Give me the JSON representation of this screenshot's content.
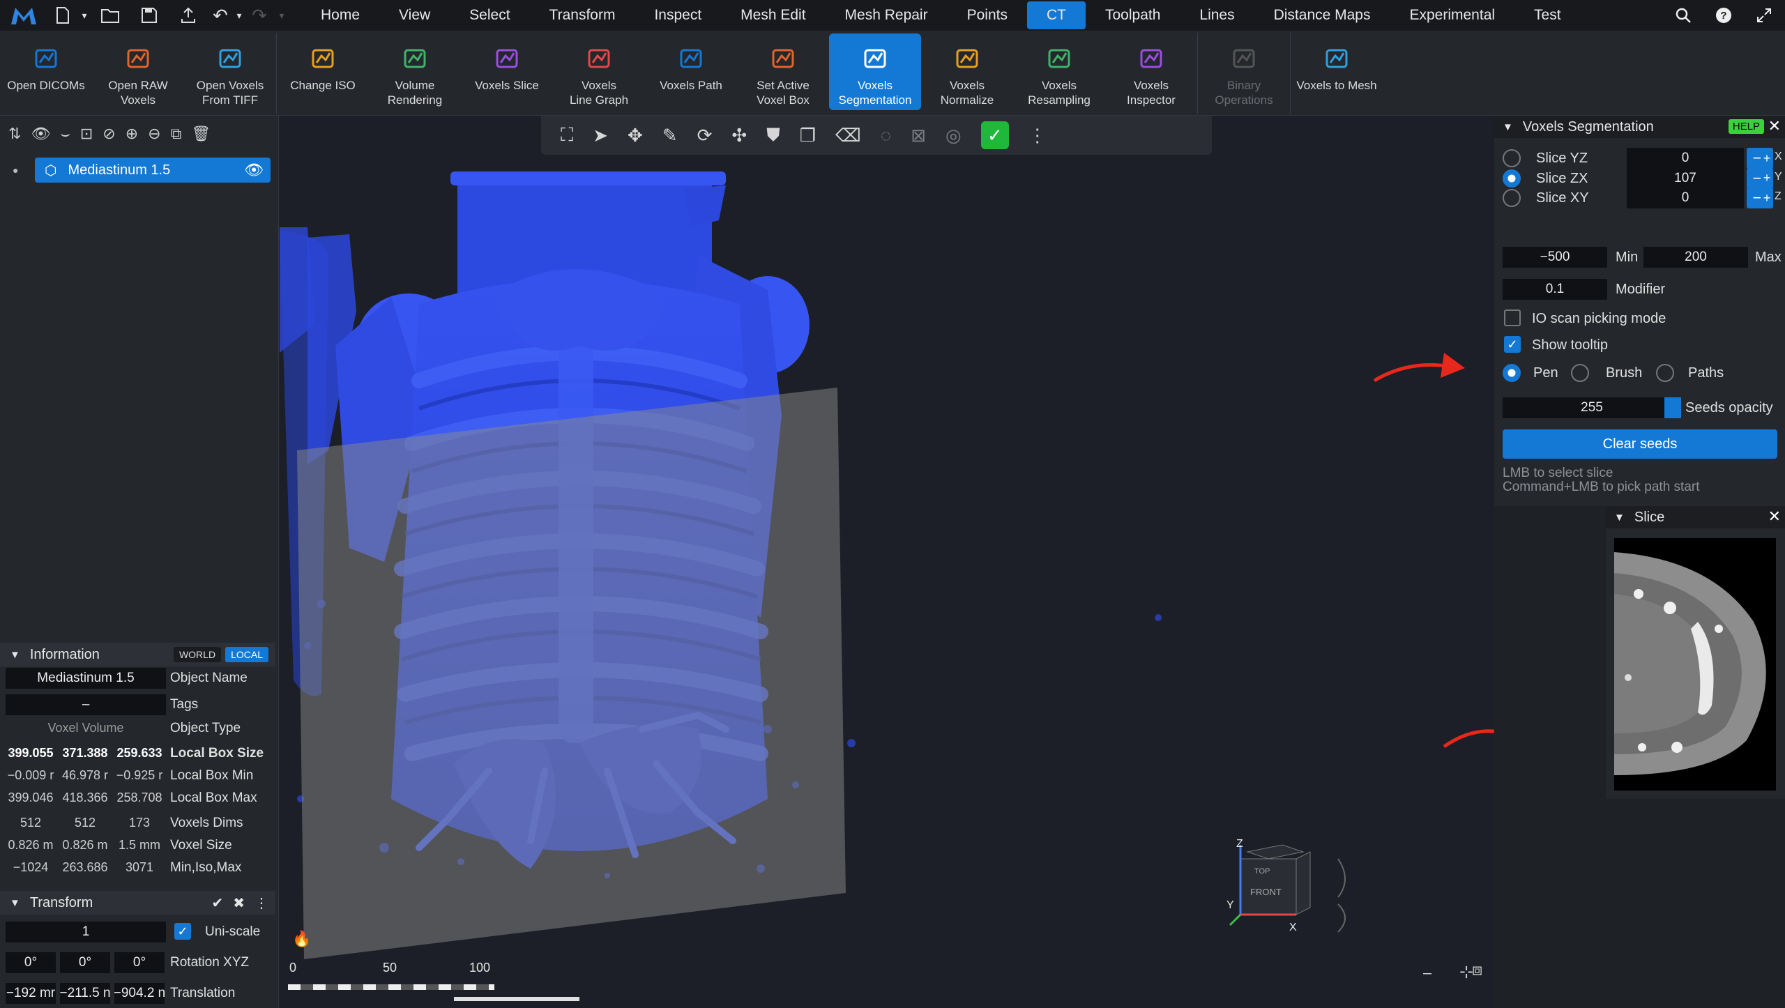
{
  "menubar": {
    "tabs": [
      "Home",
      "View",
      "Select",
      "Transform",
      "Inspect",
      "Mesh Edit",
      "Mesh Repair",
      "Points",
      "CT",
      "Toolpath",
      "Lines",
      "Distance Maps",
      "Experimental",
      "Test"
    ],
    "active_tab": "CT"
  },
  "ribbon": {
    "groups": [
      [
        "Open DICOMs",
        "Open RAW\nVoxels",
        "Open Voxels\nFrom TIFF"
      ],
      [
        "Change ISO",
        "Volume\nRendering",
        "Voxels Slice",
        "Voxels\nLine Graph",
        "Voxels Path",
        "Set Active\nVoxel Box",
        "Voxels\nSegmentation",
        "Voxels\nNormalize",
        "Voxels\nResampling",
        "Voxels\nInspector"
      ],
      [
        "Binary\nOperations"
      ],
      [
        "Voxels to Mesh"
      ]
    ],
    "active": "Voxels\nSegmentation",
    "disabled": [
      "Binary\nOperations"
    ]
  },
  "scene": {
    "object_name": "Mediastinum 1.5"
  },
  "information": {
    "title": "Information",
    "world_label": "WORLD",
    "local_label": "LOCAL",
    "object_name_value": "Mediastinum 1.5",
    "object_name_label": "Object Name",
    "tags_value": "–",
    "tags_label": "Tags",
    "object_type_value": "Voxel Volume",
    "object_type_label": "Object Type",
    "local_box_size": [
      "399.055",
      "371.388",
      "259.633"
    ],
    "local_box_size_label": "Local Box Size",
    "local_box_min": [
      "−0.009 r",
      "46.978 r",
      "−0.925 r"
    ],
    "local_box_min_label": "Local Box Min",
    "local_box_max": [
      "399.046",
      "418.366",
      "258.708"
    ],
    "local_box_max_label": "Local Box Max",
    "voxels_dims": [
      "512",
      "512",
      "173"
    ],
    "voxels_dims_label": "Voxels Dims",
    "voxel_size": [
      "0.826 m",
      "0.826 m",
      "1.5 mm"
    ],
    "voxel_size_label": "Voxel Size",
    "min_iso_max": [
      "−1024",
      "263.686",
      "3071"
    ],
    "min_iso_max_label": "Min,Iso,Max"
  },
  "transform": {
    "title": "Transform",
    "scale_value": "1",
    "uniscale_label": "Uni-scale",
    "rotation": [
      "0°",
      "0°",
      "0°"
    ],
    "rotation_label": "Rotation XYZ",
    "translation": [
      "−192 mr",
      "−211.5 n",
      "−904.2 n"
    ],
    "translation_label": "Translation"
  },
  "segmentation": {
    "title": "Voxels Segmentation",
    "help_label": "HELP",
    "slices": [
      {
        "label": "Slice YZ",
        "value": "0",
        "axis": "X",
        "selected": false
      },
      {
        "label": "Slice ZX",
        "value": "107",
        "axis": "Y",
        "selected": true
      },
      {
        "label": "Slice XY",
        "value": "0",
        "axis": "Z",
        "selected": false
      }
    ],
    "min_value": "−500",
    "min_label": "Min",
    "max_value": "200",
    "max_label": "Max",
    "modifier_value": "0.1",
    "modifier_label": "Modifier",
    "io_scan_label": "IO scan picking mode",
    "io_scan_checked": false,
    "show_tooltip_label": "Show tooltip",
    "show_tooltip_checked": true,
    "tools": [
      "Pen",
      "Brush",
      "Paths"
    ],
    "selected_tool": "Pen",
    "seeds_opacity_value": "255",
    "seeds_opacity_label": "Seeds opacity",
    "clear_seeds_label": "Clear seeds",
    "hint1": "LMB to select slice",
    "hint2": "Command+LMB to pick path start"
  },
  "slice_panel": {
    "title": "Slice"
  },
  "scale_bar": {
    "labels": [
      "0",
      "50",
      "100"
    ]
  },
  "view_cube": {
    "top": "TOP",
    "front": "FRONT",
    "axis_z": "Z",
    "axis_y": "Y",
    "axis_x": "X"
  },
  "colors": {
    "accent": "#1479d4",
    "model": "#2f4fe8",
    "annotation_arrow": "#e8281c"
  }
}
